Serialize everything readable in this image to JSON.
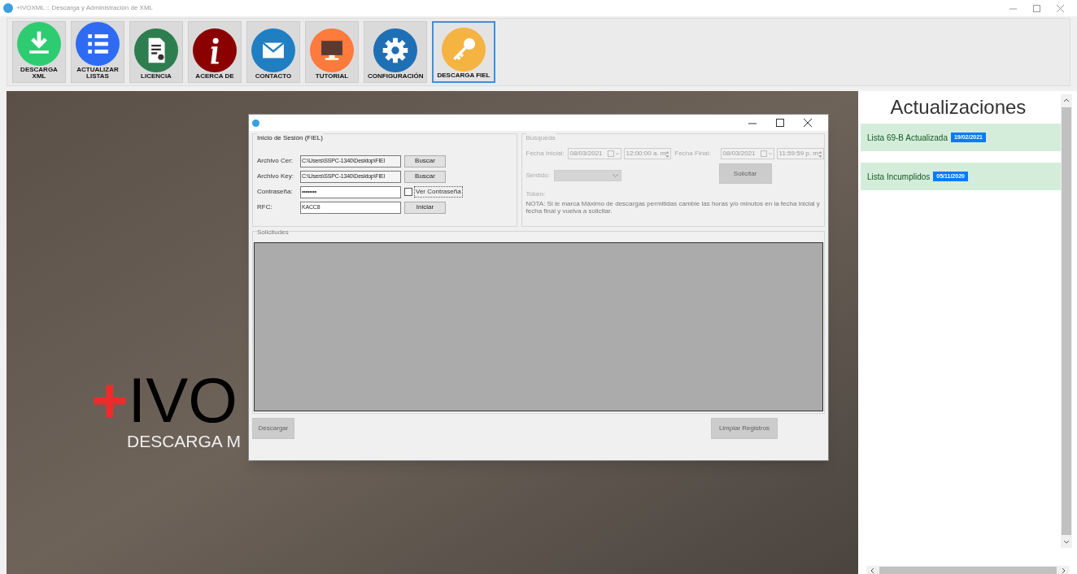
{
  "window": {
    "title": "+IVOXML :: Descarga y Administración de XML"
  },
  "toolbar": [
    {
      "label": "DESCARGA\nXML",
      "kind": "download",
      "color": "#2ecc71",
      "selected": false
    },
    {
      "label": "ACTUALIZAR\nLISTAS",
      "kind": "list",
      "color": "#2f6bf2",
      "selected": false
    },
    {
      "label": "LICENCIA",
      "kind": "certificate",
      "color": "#2e7d4f",
      "selected": false
    },
    {
      "label": "ACERCA DE",
      "kind": "info",
      "color": "#8b0000",
      "selected": false
    },
    {
      "label": "CONTACTO",
      "kind": "mail",
      "color": "#1f7fc2",
      "selected": false
    },
    {
      "label": "TUTORIAL",
      "kind": "monitor",
      "color": "#ff7a3d",
      "selected": false
    },
    {
      "label": "CONFIGURACIÓN",
      "kind": "gear",
      "color": "#1f6fb5",
      "selected": false
    },
    {
      "label": "DESCARGA FIEL",
      "kind": "key",
      "color": "#f5b342",
      "selected": true
    }
  ],
  "background": {
    "logo_mark": "+",
    "logo_name": "IVO",
    "tagline": "DESCARGA M"
  },
  "dialog": {
    "login": {
      "title": "Inicio de Sesión (FIEL)",
      "rows": [
        {
          "kind": "file",
          "label": "Archivo Cer:",
          "value": "C:\\Users\\SSPC-1340\\Desktop\\FIEl",
          "button": "Buscar"
        },
        {
          "kind": "file",
          "label": "Archivo Key:",
          "value": "C:\\Users\\SSPC-1340\\Desktop\\FIEl",
          "button": "Buscar"
        },
        {
          "kind": "password",
          "label": "Contraseña:",
          "value": "••••••••",
          "check_label": "Ver Contraseña",
          "checked": false
        },
        {
          "kind": "text",
          "label": "RFC:",
          "value": "KACC8",
          "button": "Iniciar"
        }
      ]
    },
    "search": {
      "title": "Busqueda",
      "disabled": true,
      "start_label": "Fecha Inicial:",
      "start_date": "08/03/2021",
      "start_time": "12:00:00 a. m",
      "end_label": "Fecha Final:",
      "end_date": "08/03/2021",
      "end_time": "11:59:59 p. m",
      "direction_label": "Sentido:",
      "request_button": "Solicitar",
      "token_label": "Token:",
      "note": "NOTA: Si le marca Máximo de descargas permitidas cambie las horas y/o minutos en la fecha inicial y fecha final y vuelva a solicitar."
    },
    "requests": {
      "title": "Solicitudes"
    },
    "buttons": [
      {
        "label": "Descargar",
        "disabled": true
      },
      {
        "label": "Limpiar Registros",
        "disabled": true
      }
    ]
  },
  "updates": {
    "title": "Actualizaciones",
    "items": [
      {
        "text": "Lista 69-B Actualizada",
        "date": "19/02/2021"
      },
      {
        "text": "Lista Incumplidos",
        "date": "05/11/2020"
      }
    ]
  }
}
